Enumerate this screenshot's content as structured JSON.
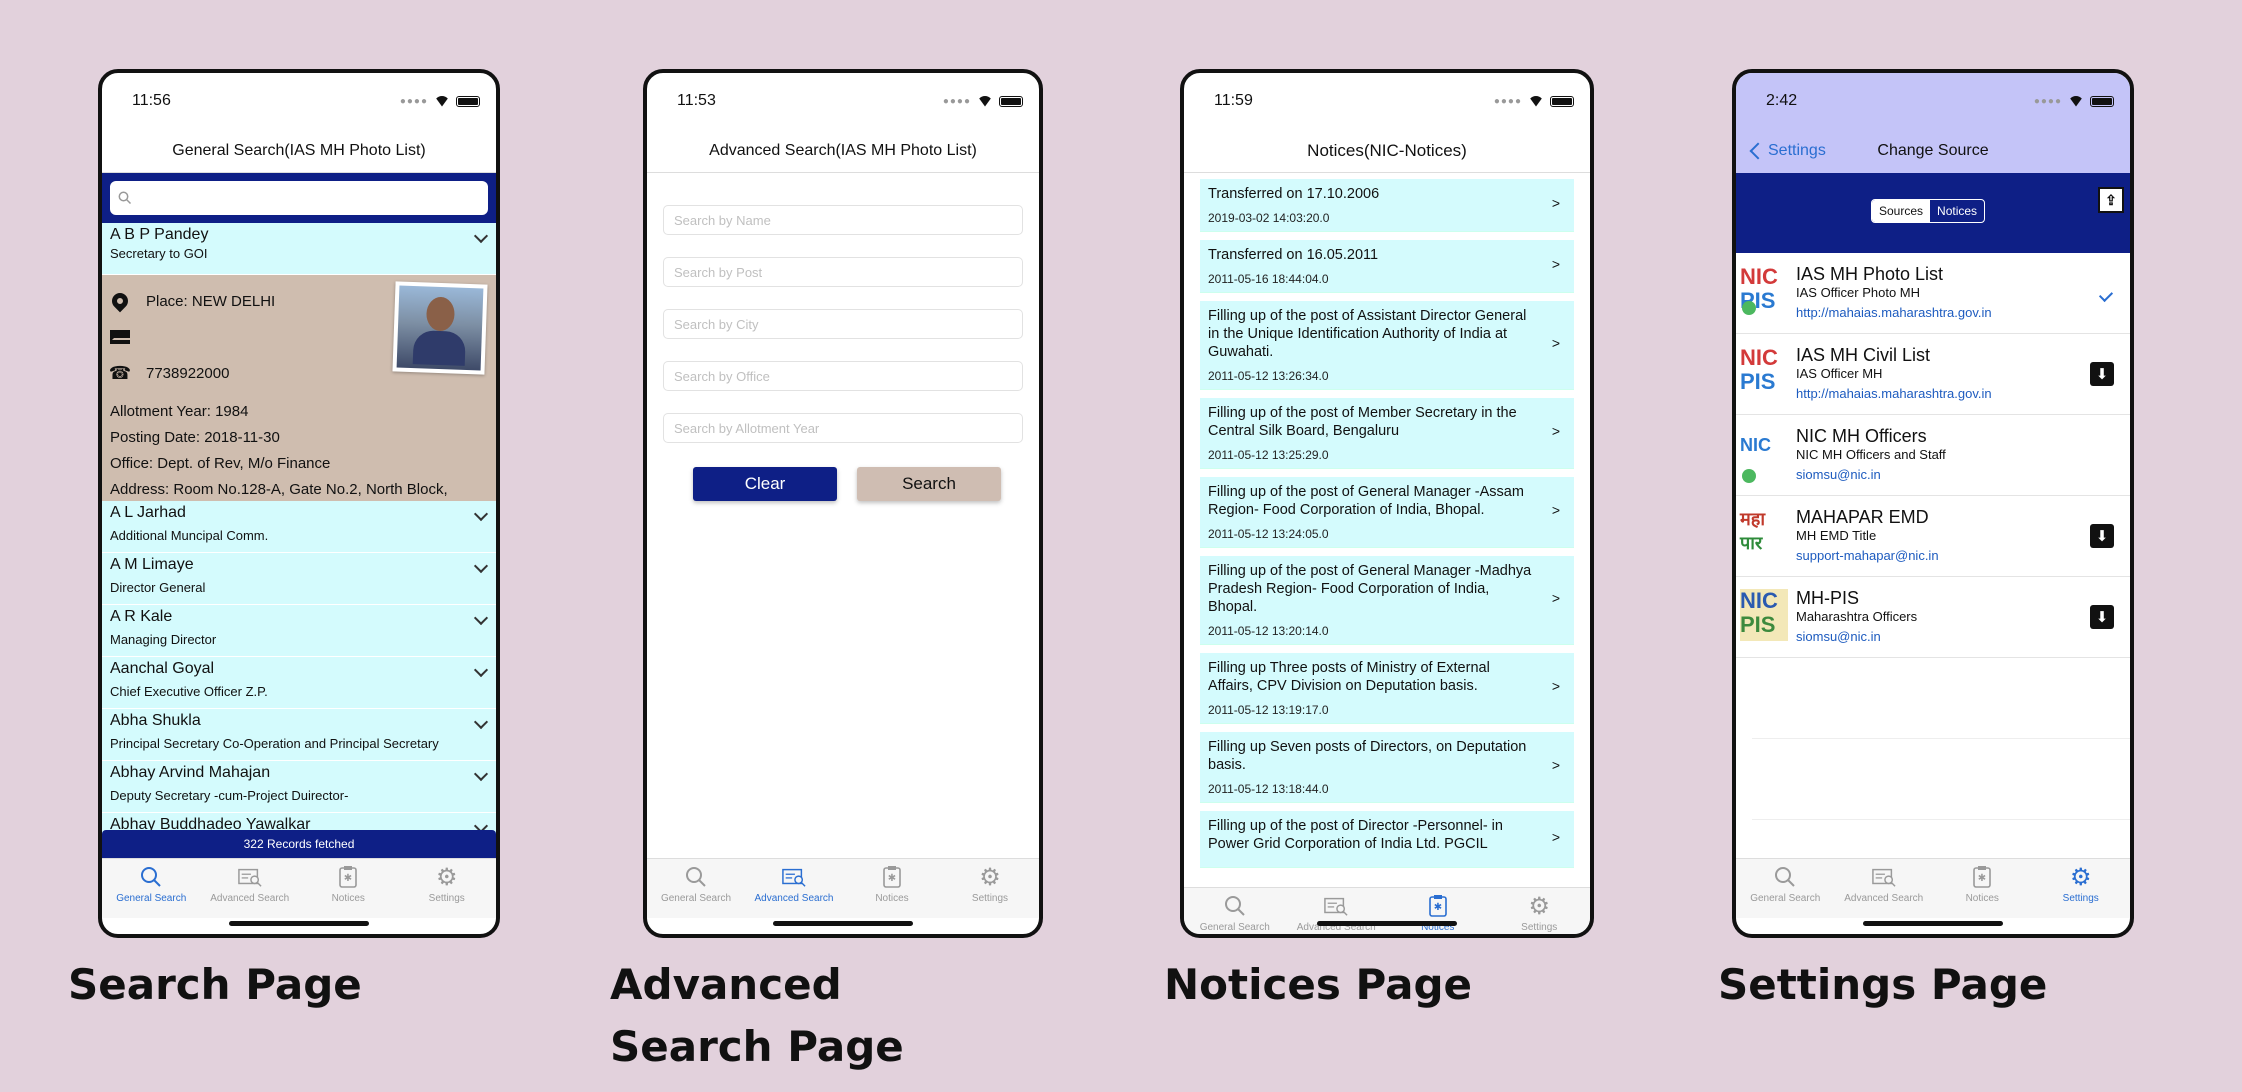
{
  "captions": {
    "search": "Search Page",
    "advanced_line1": "Advanced",
    "advanced_line2": "Search Page",
    "notices": "Notices Page",
    "settings": "Settings Page"
  },
  "tabs": [
    "General Search",
    "Advanced Search",
    "Notices",
    "Settings"
  ],
  "phone1": {
    "time": "11:56",
    "title": "General Search(IAS MH Photo List)",
    "search_placeholder": "",
    "expanded": {
      "name": "A B P Pandey",
      "post": "Secretary to GOI",
      "place": "Place: NEW DELHI",
      "phone": "7738922000",
      "allotment": "Allotment Year: 1984",
      "posting": "Posting Date: 2018-11-30",
      "office": "Office: Dept. of Rev, M/o Finance",
      "address": "Address: Room No.128-A, Gate No.2, North Block,"
    },
    "people": [
      {
        "name": "A L Jarhad",
        "post": "Additional Muncipal Comm."
      },
      {
        "name": "A M Limaye",
        "post": "Director General"
      },
      {
        "name": "A R Kale",
        "post": "Managing Director"
      },
      {
        "name": "Aanchal  Goyal",
        "post": "Chief Executive Officer Z.P."
      },
      {
        "name": "Abha  Shukla",
        "post": "Principal Secretary Co-Operation  and Principal Secretary"
      },
      {
        "name": "Abhay Arvind Mahajan",
        "post": "Deputy Secretary   -cum-Project Duirector-"
      },
      {
        "name": "Abhay Buddhadeo Yawalkar",
        "post": ""
      }
    ],
    "records": "322 Records fetched"
  },
  "phone2": {
    "time": "11:53",
    "title": "Advanced Search(IAS MH Photo List)",
    "fields": [
      "Search by Name",
      "Search by Post",
      "Search by City",
      "Search by Office",
      "Search by Allotment Year"
    ],
    "clear_label": "Clear",
    "search_label": "Search"
  },
  "phone3": {
    "time": "11:59",
    "title": "Notices(NIC-Notices)",
    "arrow": ">",
    "notices": [
      {
        "title": "Transferred on 17.10.2006",
        "date": "2019-03-02 14:03:20.0"
      },
      {
        "title": "Transferred on 16.05.2011",
        "date": "2011-05-16 18:44:04.0"
      },
      {
        "title": "Filling up of the post of Assistant Director General in the Unique Identification Authority of India at Guwahati.",
        "date": "2011-05-12 13:26:34.0"
      },
      {
        "title": "Filling up of the post of Member Secretary in the Central Silk Board, Bengaluru",
        "date": "2011-05-12 13:25:29.0"
      },
      {
        "title": "Filling up of the post of General Manager -Assam Region- Food Corporation of India, Bhopal.",
        "date": "2011-05-12 13:24:05.0"
      },
      {
        "title": "Filling up of the post of General Manager -Madhya Pradesh Region- Food Corporation of India, Bhopal.",
        "date": "2011-05-12 13:20:14.0"
      },
      {
        "title": "Filling up Three posts of Ministry of External Affairs, CPV Division on Deputation basis.",
        "date": "2011-05-12 13:19:17.0"
      },
      {
        "title": "Filling up Seven posts of Directors, on Deputation basis.",
        "date": "2011-05-12 13:18:44.0"
      },
      {
        "title": "Filling up of the post of Director -Personnel- in Power Grid Corporation of India Ltd. PGCIL",
        "date": ""
      }
    ]
  },
  "phone4": {
    "time": "2:42",
    "back_label": "Settings",
    "title": "Change Source",
    "seg_sources": "Sources",
    "seg_notices": "Notices",
    "sources": [
      {
        "logo_top": "NIC",
        "logo_bottom": "PIS",
        "name": "IAS MH Photo List",
        "sub": "IAS Officer Photo MH",
        "link": "http://mahaias.maharashtra.gov.in",
        "state": "selected"
      },
      {
        "logo_top": "NIC",
        "logo_bottom": "PIS",
        "name": "IAS MH Civil List",
        "sub": "IAS Officer MH",
        "link": "http://mahaias.maharashtra.gov.in",
        "state": "download"
      },
      {
        "logo_top": "NIC",
        "logo_bottom": "",
        "name": "NIC MH Officers",
        "sub": "NIC MH Officers and Staff",
        "link": "siomsu@nic.in",
        "state": "none"
      },
      {
        "logo_top": "महा",
        "logo_bottom": "पार",
        "name": "MAHAPAR EMD",
        "sub": "MH EMD Title",
        "link": "support-mahapar@nic.in",
        "state": "download"
      },
      {
        "logo_top": "NIC",
        "logo_bottom": "PIS",
        "name": "MH-PIS",
        "sub": "Maharashtra Officers",
        "link": "siomsu@nic.in",
        "state": "download"
      }
    ]
  }
}
